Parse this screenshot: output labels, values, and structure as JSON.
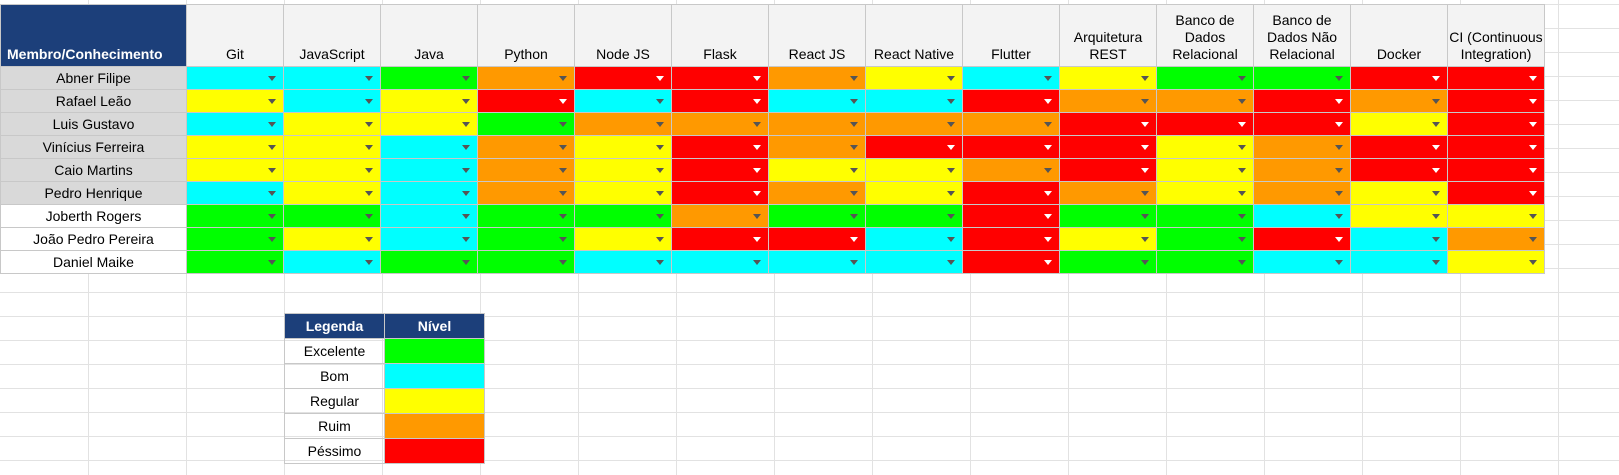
{
  "colors": {
    "Excelente": "#00ff00",
    "Bom": "#00ffff",
    "Regular": "#ffff00",
    "Ruim": "#ff9900",
    "Péssimo": "#ff0000"
  },
  "header": {
    "corner": "Membro/Conhecimento",
    "skills": [
      "Git",
      "JavaScript",
      "Java",
      "Python",
      "Node JS",
      "Flask",
      "React JS",
      "React Native",
      "Flutter",
      "Arquitetura REST",
      "Banco de Dados Relacional",
      "Banco de Dados Não Relacional",
      "Docker",
      "CI (Continuous Integration)"
    ]
  },
  "members": [
    {
      "name": "Abner Filipe",
      "levels": [
        "Bom",
        "Bom",
        "Excelente",
        "Ruim",
        "Péssimo",
        "Péssimo",
        "Ruim",
        "Regular",
        "Bom",
        "Regular",
        "Excelente",
        "Excelente",
        "Péssimo",
        "Péssimo"
      ]
    },
    {
      "name": "Rafael Leão",
      "levels": [
        "Regular",
        "Bom",
        "Regular",
        "Péssimo",
        "Bom",
        "Péssimo",
        "Bom",
        "Bom",
        "Péssimo",
        "Ruim",
        "Ruim",
        "Péssimo",
        "Ruim",
        "Péssimo"
      ]
    },
    {
      "name": "Luis Gustavo",
      "levels": [
        "Bom",
        "Regular",
        "Regular",
        "Excelente",
        "Ruim",
        "Ruim",
        "Ruim",
        "Ruim",
        "Ruim",
        "Péssimo",
        "Péssimo",
        "Péssimo",
        "Regular",
        "Péssimo"
      ]
    },
    {
      "name": "Vinícius Ferreira",
      "levels": [
        "Regular",
        "Regular",
        "Bom",
        "Ruim",
        "Regular",
        "Péssimo",
        "Ruim",
        "Péssimo",
        "Péssimo",
        "Péssimo",
        "Regular",
        "Ruim",
        "Péssimo",
        "Péssimo"
      ]
    },
    {
      "name": "Caio Martins",
      "levels": [
        "Regular",
        "Regular",
        "Bom",
        "Ruim",
        "Regular",
        "Péssimo",
        "Regular",
        "Regular",
        "Ruim",
        "Péssimo",
        "Regular",
        "Ruim",
        "Péssimo",
        "Péssimo"
      ]
    },
    {
      "name": "Pedro Henrique",
      "levels": [
        "Bom",
        "Regular",
        "Bom",
        "Ruim",
        "Regular",
        "Péssimo",
        "Ruim",
        "Regular",
        "Péssimo",
        "Ruim",
        "Regular",
        "Ruim",
        "Regular",
        "Péssimo"
      ]
    },
    {
      "name": "Joberth Rogers",
      "levels": [
        "Excelente",
        "Excelente",
        "Bom",
        "Excelente",
        "Excelente",
        "Ruim",
        "Excelente",
        "Excelente",
        "Péssimo",
        "Excelente",
        "Excelente",
        "Bom",
        "Regular",
        "Regular"
      ]
    },
    {
      "name": "João Pedro Pereira",
      "levels": [
        "Excelente",
        "Regular",
        "Bom",
        "Excelente",
        "Regular",
        "Péssimo",
        "Péssimo",
        "Bom",
        "Péssimo",
        "Regular",
        "Excelente",
        "Péssimo",
        "Bom",
        "Ruim"
      ]
    },
    {
      "name": "Daniel Maike",
      "levels": [
        "Excelente",
        "Bom",
        "Excelente",
        "Excelente",
        "Bom",
        "Bom",
        "Bom",
        "Bom",
        "Péssimo",
        "Excelente",
        "Excelente",
        "Bom",
        "Bom",
        "Regular"
      ]
    }
  ],
  "legend": {
    "title": "Legenda",
    "level_header": "Nível",
    "items": [
      {
        "label": "Excelente",
        "color": "#00ff00"
      },
      {
        "label": "Bom",
        "color": "#00ffff"
      },
      {
        "label": "Regular",
        "color": "#ffff00"
      },
      {
        "label": "Ruim",
        "color": "#ff9900"
      },
      {
        "label": "Péssimo",
        "color": "#ff0000"
      }
    ]
  },
  "icons": {
    "dropdown": "dropdown-arrow-icon"
  }
}
